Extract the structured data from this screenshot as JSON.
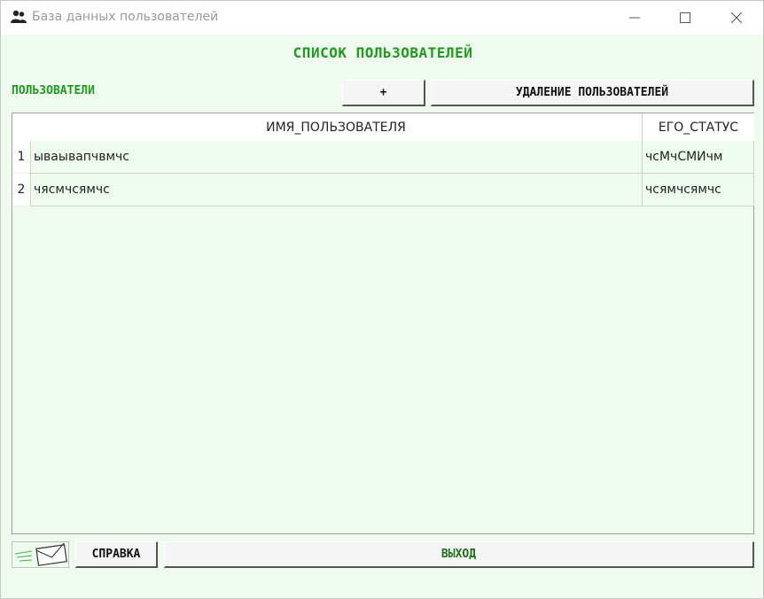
{
  "window": {
    "title": "База данных пользователей"
  },
  "heading": "СПИСОК ПОЛЬЗОВАТЕЛЕЙ",
  "users_label": "ПОЛЬЗОВАТЕЛИ",
  "toolbar": {
    "add_label": "+",
    "delete_label": "УДАЛЕНИЕ ПОЛЬЗОВАТЕЛЕЙ"
  },
  "table": {
    "columns": [
      "ИМЯ_ПОЛЬЗОВАТЕЛЯ",
      "ЕГО_СТАТУС"
    ],
    "rows": [
      {
        "num": "1",
        "name": "ываывапчвмчс",
        "status": "чсМчСМИчм"
      },
      {
        "num": "2",
        "name": "чясмчсямчс",
        "status": "чсямчсямчс"
      }
    ]
  },
  "footer": {
    "help_label": "СПРАВКА",
    "exit_label": "ВЫХОД"
  },
  "colors": {
    "accent_green": "#1e9a1e",
    "background": "#f0fbf0"
  }
}
